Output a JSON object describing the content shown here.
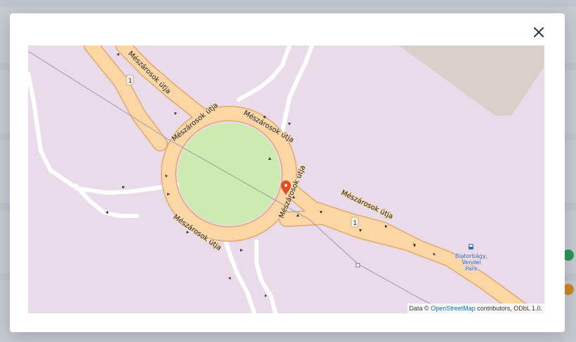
{
  "modal": {
    "close_icon": "close-icon"
  },
  "map": {
    "colors": {
      "land": "#e9dbea",
      "park": "#cdebb0",
      "road_fill": "#fcd6a4",
      "road_casing": "#e3a870",
      "service_road": "#ffffff",
      "building": "#d9d0c9",
      "boundary": "#9e98a6",
      "marker": "#e34b28"
    },
    "street_name": "Mészárosok útja",
    "route_ref": "1",
    "poi": {
      "icon": "bus-stop-icon",
      "name_line1": "Biatorbágy,",
      "name_line2": "Vendel",
      "name_line3": "Park"
    },
    "marker_icon": "map-pin-icon",
    "attribution": {
      "prefix": "Data ©",
      "link_text": "OpenStreetMap",
      "suffix": "contributors, ODbL 1.0."
    }
  }
}
